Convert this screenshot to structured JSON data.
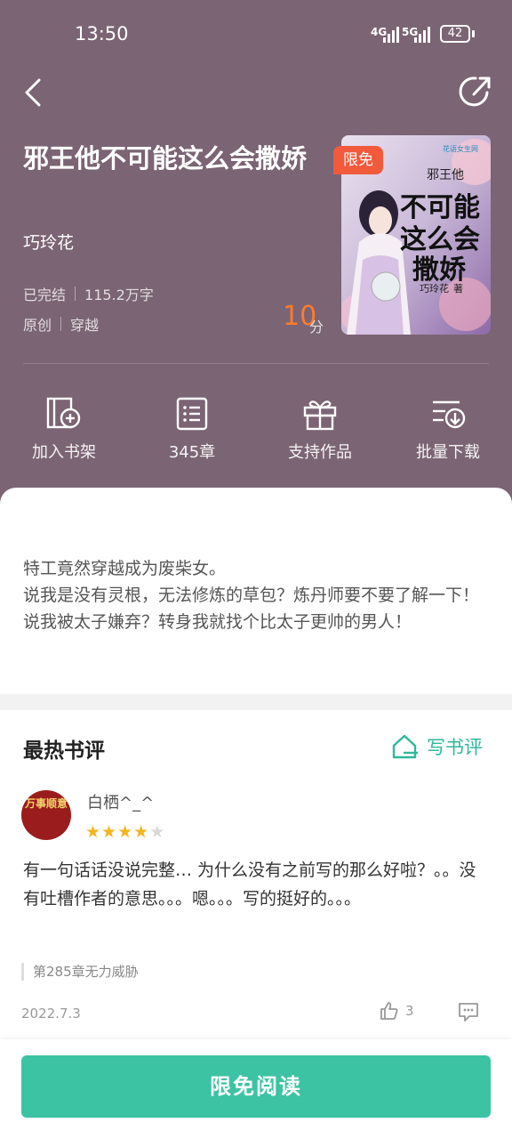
{
  "status_bar": {
    "time": "13:50",
    "network_1": "4G",
    "network_2": "5G",
    "battery": "42"
  },
  "book": {
    "title": "邪王他不可能这么会撒娇",
    "author": "巧玲花",
    "status": "已完结",
    "word_count": "115.2万字",
    "category_1": "原创",
    "category_2": "穿越",
    "score": "10",
    "score_unit": "分",
    "badge": "限免",
    "cover_text": {
      "publisher": "花语女生网",
      "small_title": "邪王他",
      "big_line_1": "不可能",
      "big_line_2": "这么会",
      "big_line_3": "撒娇",
      "author_sign": "巧玲花",
      "author_suffix": "著"
    }
  },
  "actions": [
    {
      "label": "加入书架",
      "icon": "add-bookshelf-icon"
    },
    {
      "label": "345章",
      "icon": "chapter-list-icon"
    },
    {
      "label": "支持作品",
      "icon": "gift-icon"
    },
    {
      "label": "批量下载",
      "icon": "download-icon"
    }
  ],
  "description": [
    "特工竟然穿越成为废柴女。",
    "说我是没有灵根，无法修炼的草包？炼丹师要不要了解一下！",
    "说我被太子嫌弃？转身我就找个比太子更帅的男人！"
  ],
  "reviews": {
    "section_title": "最热书评",
    "write_label": "写书评",
    "items": [
      {
        "user": "白栖^_^",
        "avatar_text": "万事顺意",
        "rating": 4,
        "rating_max": 5,
        "text": "有一句话话没说完整… 为什么没有之前写的那么好啦？。。没有吐槽作者的意思。。。嗯。。。写的挺好的。。。",
        "chapter": "第285章无力威胁",
        "date": "2022.7.3",
        "likes": "3"
      }
    ]
  },
  "bottom": {
    "read_button": "限免阅读"
  },
  "colors": {
    "hero_bg": "#7b6474",
    "accent_green": "#3cc3a3",
    "score_orange": "#ff7a2e",
    "badge_red": "#f25a3c",
    "star_gold": "#f3b41c"
  }
}
